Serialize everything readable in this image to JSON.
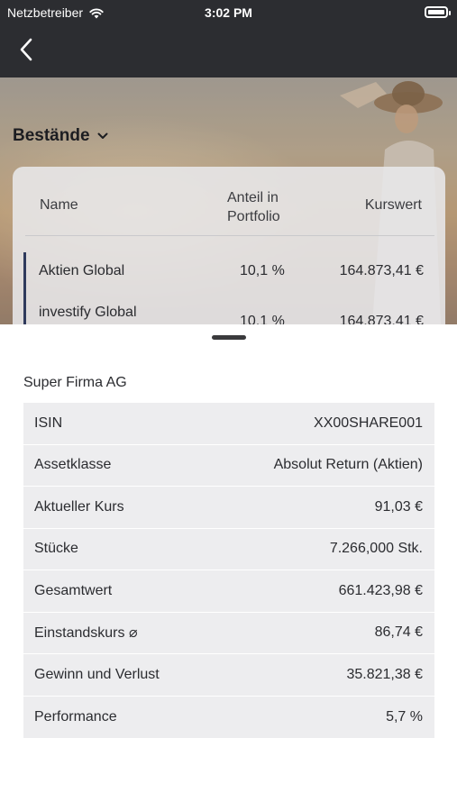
{
  "status_bar": {
    "carrier": "Netzbetreiber",
    "time": "3:02 PM"
  },
  "section": {
    "title": "Bestände"
  },
  "holdings": {
    "columns": {
      "name": "Name",
      "share_line1": "Anteil in",
      "share_line2": "Portfolio",
      "value": "Kurswert"
    },
    "rows": [
      {
        "name": "Aktien Global",
        "share": "10,1 %",
        "value": "164.873,41 €"
      },
      {
        "name": "investify Global",
        "share": "10,1 %",
        "value": "164.873,41 €"
      }
    ],
    "accent_color": "#2f3a5c"
  },
  "detail": {
    "title": "Super Firma AG",
    "rows": [
      {
        "label": "ISIN",
        "value": "XX00SHARE001"
      },
      {
        "label": "Assetklasse",
        "value": "Absolut Return (Aktien)"
      },
      {
        "label": "Aktueller Kurs",
        "value": "91,03 €"
      },
      {
        "label": "Stücke",
        "value": "7.266,000 Stk."
      },
      {
        "label": "Gesamtwert",
        "value": "661.423,98 €"
      },
      {
        "label": "Einstandskurs ⌀",
        "value": "86,74 €"
      },
      {
        "label": "Gewinn und Verlust",
        "value": "35.821,38 €"
      },
      {
        "label": "Performance",
        "value": "5,7 %"
      }
    ]
  },
  "icons": {
    "back": "chevron-left-icon",
    "wifi": "wifi-icon",
    "battery": "battery-icon",
    "dropdown": "chevron-down-icon"
  },
  "colors": {
    "nav_background": "#2c2d31",
    "sheet_background": "#ffffff",
    "row_background": "#ededef"
  }
}
